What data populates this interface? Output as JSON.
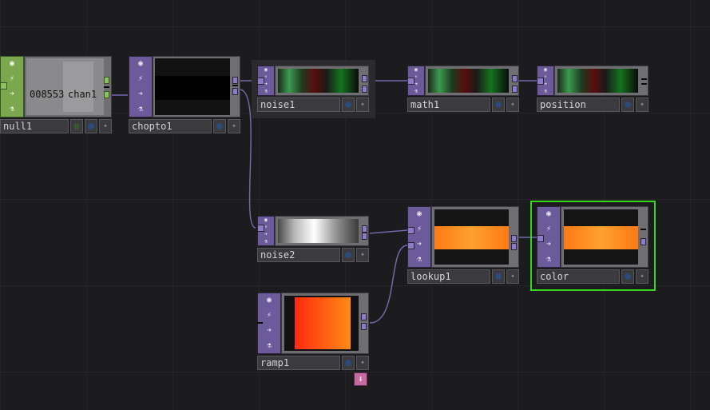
{
  "nodes": {
    "null1": {
      "name": "null1",
      "value": "008553",
      "channel": "chan1"
    },
    "chopto1": {
      "name": "chopto1"
    },
    "noise1": {
      "name": "noise1"
    },
    "math1": {
      "name": "math1"
    },
    "position": {
      "name": "position"
    },
    "noise2": {
      "name": "noise2"
    },
    "lookup1": {
      "name": "lookup1"
    },
    "color": {
      "name": "color"
    },
    "ramp1": {
      "name": "ramp1"
    }
  },
  "icons": {
    "viewer": "◉",
    "cook": "⚡",
    "export": "➔",
    "clone": "⚗",
    "star": "✦",
    "download": "⬇"
  },
  "colors": {
    "chop_family": "#6b5b9a",
    "top_family": "#6b5b9a",
    "dat_family": "#7ba84e",
    "selected": "#35d61c",
    "wire": "#7466a8"
  }
}
